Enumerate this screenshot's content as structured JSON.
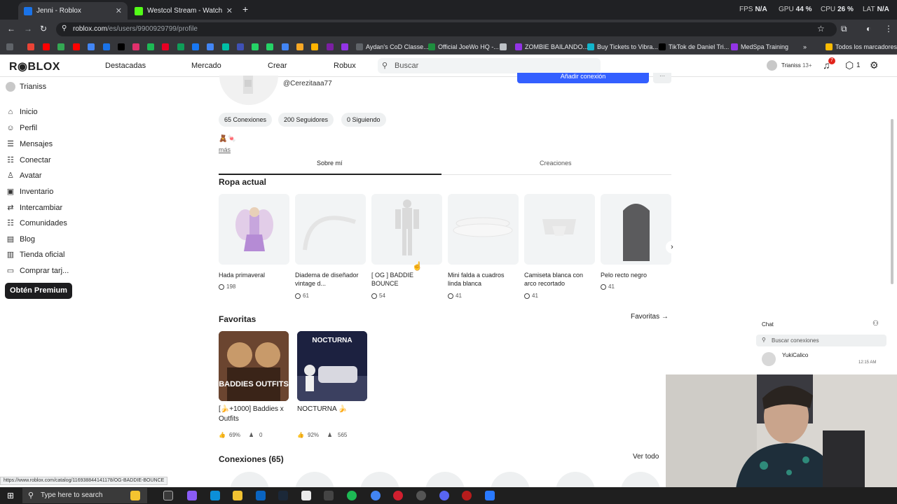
{
  "browser": {
    "tabs": [
      {
        "title": "Jenni - Roblox",
        "color": "#1a73e8",
        "active": true
      },
      {
        "title": "Westcol Stream - Watch Live on",
        "color": "#53fc18",
        "active": false
      }
    ],
    "new_tab": "+",
    "stats": [
      {
        "label": "FPS",
        "value": "N/A"
      },
      {
        "label": "GPU",
        "value": "44 %"
      },
      {
        "label": "CPU",
        "value": "26 %"
      },
      {
        "label": "LAT",
        "value": "N/A"
      }
    ],
    "url_host": "roblox.com",
    "url_path": "/es/users/9900929799/profile",
    "bookmarks": [
      {
        "label": "Aydan's CoD Classe...",
        "color": "#5f6368"
      },
      {
        "label": "Official JoeWo HQ -...",
        "color": "#1e8e3e"
      },
      {
        "label": "ZOMBIE BAILANDO...",
        "color": "#9334e6"
      },
      {
        "label": "Buy Tickets to Vibra...",
        "color": "#12b5cb"
      },
      {
        "label": "TikTok de Daniel Tri...",
        "color": "#000000"
      },
      {
        "label": "MedSpa Training",
        "color": "#9334e6"
      },
      {
        "label": "Todos los marcadores",
        "color": "#fbbc04"
      }
    ]
  },
  "header": {
    "logo": "R◉BLOX",
    "nav": [
      "Destacadas",
      "Mercado",
      "Crear",
      "Robux"
    ],
    "search_placeholder": "Buscar",
    "username": "Trianiss",
    "age_tag": "13+",
    "notif_count": "7",
    "robux_count": "1"
  },
  "sidebar": {
    "user": "Trianiss",
    "items": [
      {
        "label": "Inicio",
        "icon": "home-icon",
        "glyph": "⌂"
      },
      {
        "label": "Perfil",
        "icon": "profile-icon",
        "glyph": "☺"
      },
      {
        "label": "Mensajes",
        "icon": "messages-icon",
        "glyph": "☰"
      },
      {
        "label": "Conectar",
        "icon": "connect-icon",
        "glyph": "☷"
      },
      {
        "label": "Avatar",
        "icon": "avatar-icon",
        "glyph": "♙"
      },
      {
        "label": "Inventario",
        "icon": "inventory-icon",
        "glyph": "▣"
      },
      {
        "label": "Intercambiar",
        "icon": "trade-icon",
        "glyph": "⇄"
      },
      {
        "label": "Comunidades",
        "icon": "communities-icon",
        "glyph": "☷"
      },
      {
        "label": "Blog",
        "icon": "blog-icon",
        "glyph": "▤"
      },
      {
        "label": "Tienda oficial",
        "icon": "store-icon",
        "glyph": "▥"
      },
      {
        "label": "Comprar tarj...",
        "icon": "giftcard-icon",
        "glyph": "▭"
      }
    ],
    "premium": "Obtén Premium"
  },
  "profile": {
    "handle": "@Cerezitaaa77",
    "add_connection": "Añadir conexión",
    "more": "···",
    "pills": [
      "65 Conexiones",
      "200 Seguidores",
      "0 Siguiendo"
    ],
    "bio": "🧸🍬",
    "more_link": "más",
    "tabs": [
      "Sobre mí",
      "Creaciones"
    ]
  },
  "outfit": {
    "title": "Ropa actual",
    "items": [
      {
        "name": "Hada primaveral",
        "price": "198",
        "art": "fairy"
      },
      {
        "name": "Diadema de diseñador vintage d...",
        "price": "61",
        "art": "headband"
      },
      {
        "name": "[ OG ] BADDIE BOUNCE",
        "price": "54",
        "art": "body"
      },
      {
        "name": "Mini falda a cuadros linda blanca",
        "price": "41",
        "art": "skirt"
      },
      {
        "name": "Camiseta blanca con arco recortado",
        "price": "41",
        "art": "shirt"
      },
      {
        "name": "Pelo recto negro",
        "price": "41",
        "art": "hair"
      }
    ]
  },
  "favorites": {
    "title": "Favoritas",
    "link": "Favoritas →",
    "games": [
      {
        "name": "[🍌+1000] Baddies x Outfits",
        "rating": "69%",
        "players": "0",
        "thumb_text": "BADDIES OUTFITS",
        "bg": "#5a3a2a"
      },
      {
        "name": "NOCTURNA 🍌",
        "rating": "92%",
        "players": "565",
        "thumb_text": "NOCTURNA",
        "bg": "#2a2e4a"
      }
    ]
  },
  "connections": {
    "title": "Conexiones (65)",
    "link": "Ver todo"
  },
  "chat": {
    "title": "Chat",
    "search_placeholder": "Buscar conexiones",
    "entries": [
      {
        "name": "YukiCalico",
        "time": "12:15 AM"
      }
    ]
  },
  "status_url": "https://www.roblox.com/catalog/116938844141178/OG-BADDIE-BOUNCE",
  "taskbar": {
    "search": "Type here to search"
  },
  "colors": {
    "primary_blue": "#335fff",
    "dark": "#1d1d1f",
    "light_bg": "#f2f4f5"
  }
}
